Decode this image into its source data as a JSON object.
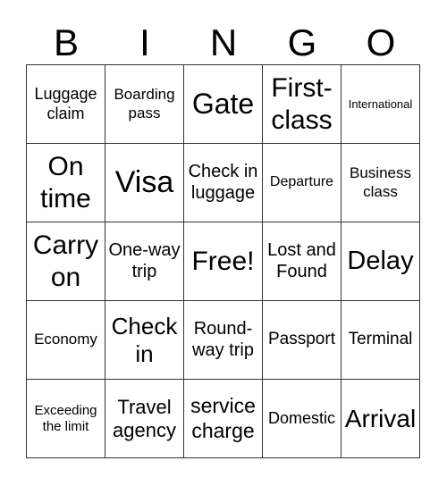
{
  "header": [
    "B",
    "I",
    "N",
    "G",
    "O"
  ],
  "cells": [
    {
      "text": "Luggage claim",
      "size": 18
    },
    {
      "text": "Boarding pass",
      "size": 17
    },
    {
      "text": "Gate",
      "size": 32
    },
    {
      "text": "First-class",
      "size": 30
    },
    {
      "text": "International",
      "size": 13
    },
    {
      "text": "On time",
      "size": 30
    },
    {
      "text": "Visa",
      "size": 34
    },
    {
      "text": "Check in luggage",
      "size": 20
    },
    {
      "text": "Departure",
      "size": 16
    },
    {
      "text": "Business class",
      "size": 17
    },
    {
      "text": "Carry on",
      "size": 30
    },
    {
      "text": "One-way trip",
      "size": 20
    },
    {
      "text": "Free!",
      "size": 30
    },
    {
      "text": "Lost and Found",
      "size": 20
    },
    {
      "text": "Delay",
      "size": 29
    },
    {
      "text": "Economy",
      "size": 17
    },
    {
      "text": "Check in",
      "size": 26
    },
    {
      "text": "Round-way trip",
      "size": 20
    },
    {
      "text": "Passport",
      "size": 19
    },
    {
      "text": "Terminal",
      "size": 19
    },
    {
      "text": "Exceeding the limit",
      "size": 15
    },
    {
      "text": "Travel agency",
      "size": 22
    },
    {
      "text": "service charge",
      "size": 23
    },
    {
      "text": "Domestic",
      "size": 18
    },
    {
      "text": "Arrival",
      "size": 28
    }
  ]
}
